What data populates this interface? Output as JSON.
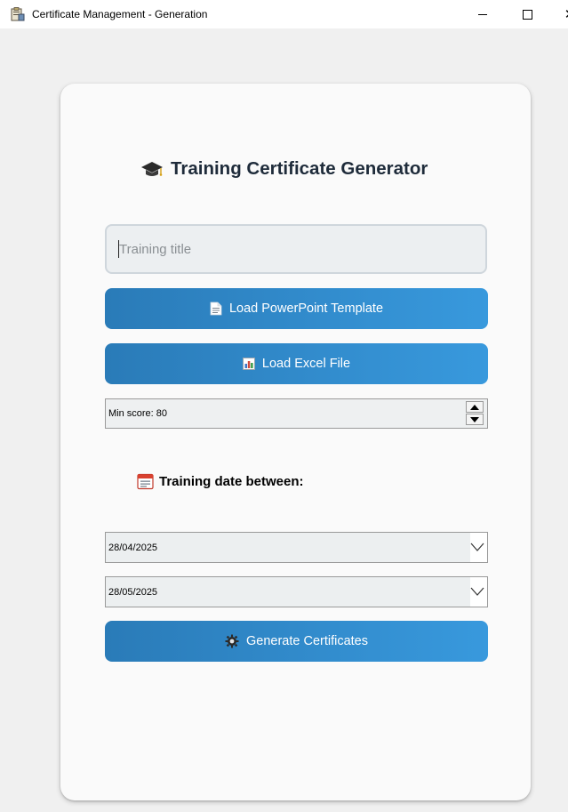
{
  "window": {
    "title": "Certificate Management - Generation"
  },
  "header": {
    "title": "Training Certificate Generator"
  },
  "form": {
    "training_title_placeholder": "Training title",
    "training_title_value": "",
    "load_ppt_label": "Load PowerPoint Template",
    "load_excel_label": "Load Excel File",
    "min_score_text": "Min score: 80",
    "date_section_label": "Training date between:",
    "date_from": "28/04/2025",
    "date_to": "28/05/2025",
    "generate_label": "Generate Certificates"
  },
  "colors": {
    "accent_start": "#2a7bb8",
    "accent_end": "#3899dd",
    "card_bg": "#fafafa",
    "window_bg": "#f0f0f0"
  },
  "icons": {
    "heading": "graduation-cap-icon",
    "ppt": "document-icon",
    "excel": "bar-chart-icon",
    "date": "calendar-icon",
    "generate": "gear-icon"
  }
}
